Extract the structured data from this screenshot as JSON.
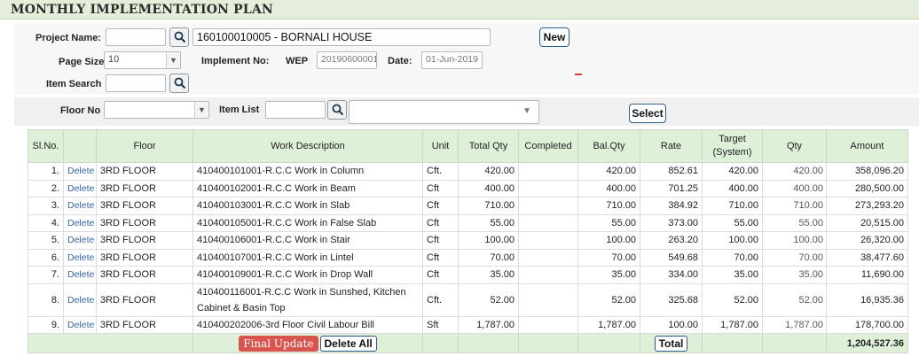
{
  "page": {
    "title": "MONTHLY IMPLEMENTATION PLAN"
  },
  "form": {
    "project_label": "Project Name:",
    "project_code": "",
    "project_name": "160100010005 - BORNALI HOUSE",
    "new_label": "New",
    "page_size_label": "Page Size",
    "page_size_value": "10",
    "implement_no_label": "Implement No:",
    "implement_prefix": "WEP",
    "implement_no_value": "20190600001",
    "date_label": "Date:",
    "date_value": "01-Jun-2019",
    "item_search_label": "Item Search",
    "item_search_value": "",
    "floor_label": "Floor No",
    "floor_value": "",
    "item_list_label": "Item List",
    "item_list_value": "",
    "item_list_select_value": "",
    "select_label": "Select"
  },
  "table": {
    "headers": {
      "sl": "Sl.No.",
      "floor": "Floor",
      "desc": "Work Description",
      "unit": "Unit",
      "total_qty": "Total Qty",
      "completed": "Completed",
      "bal_qty": "Bal.Qty",
      "rate": "Rate",
      "target_1": "Target",
      "target_2": "(System)",
      "qty": "Qty",
      "amount": "Amount"
    },
    "delete_label": "Delete",
    "rows": [
      {
        "sl": "1.",
        "floor": "3RD FLOOR",
        "desc": "410400101001-R.C.C Work in Column",
        "unit": "Cft.",
        "total_qty": "420.00",
        "completed": "",
        "bal_qty": "420.00",
        "rate": "852.61",
        "target": "420.00",
        "qty": "420.00",
        "amount": "358,096.20"
      },
      {
        "sl": "2.",
        "floor": "3RD FLOOR",
        "desc": "410400102001-R.C.C Work in Beam",
        "unit": "Cft",
        "total_qty": "400.00",
        "completed": "",
        "bal_qty": "400.00",
        "rate": "701.25",
        "target": "400.00",
        "qty": "400.00",
        "amount": "280,500.00"
      },
      {
        "sl": "3.",
        "floor": "3RD FLOOR",
        "desc": "410400103001-R.C.C Work in Slab",
        "unit": "Cft",
        "total_qty": "710.00",
        "completed": "",
        "bal_qty": "710.00",
        "rate": "384.92",
        "target": "710.00",
        "qty": "710.00",
        "amount": "273,293.20"
      },
      {
        "sl": "4.",
        "floor": "3RD FLOOR",
        "desc": "410400105001-R.C.C Work in False Slab",
        "unit": "Cft",
        "total_qty": "55.00",
        "completed": "",
        "bal_qty": "55.00",
        "rate": "373.00",
        "target": "55.00",
        "qty": "55.00",
        "amount": "20,515.00"
      },
      {
        "sl": "5.",
        "floor": "3RD FLOOR",
        "desc": "410400106001-R.C.C Work in Stair",
        "unit": "Cft",
        "total_qty": "100.00",
        "completed": "",
        "bal_qty": "100.00",
        "rate": "263.20",
        "target": "100.00",
        "qty": "100.00",
        "amount": "26,320.00"
      },
      {
        "sl": "6.",
        "floor": "3RD FLOOR",
        "desc": "410400107001-R.C.C Work in Lintel",
        "unit": "Cft",
        "total_qty": "70.00",
        "completed": "",
        "bal_qty": "70.00",
        "rate": "549.68",
        "target": "70.00",
        "qty": "70.00",
        "amount": "38,477.60"
      },
      {
        "sl": "7.",
        "floor": "3RD FLOOR",
        "desc": "410400109001-R.C.C Work in Drop Wall",
        "unit": "Cft",
        "total_qty": "35.00",
        "completed": "",
        "bal_qty": "35.00",
        "rate": "334.00",
        "target": "35.00",
        "qty": "35.00",
        "amount": "11,690.00"
      },
      {
        "sl": "8.",
        "floor": "3RD FLOOR",
        "desc": "410400116001-R.C.C Work in Sunshed, Kitchen Cabinet & Basin Top",
        "unit": "Cft.",
        "total_qty": "52.00",
        "completed": "",
        "bal_qty": "52.00",
        "rate": "325.68",
        "target": "52.00",
        "qty": "52.00",
        "amount": "16,935.36"
      },
      {
        "sl": "9.",
        "floor": "3RD FLOOR",
        "desc": "410400202006-3rd Floor Civil Labour Bill",
        "unit": "Sft",
        "total_qty": "1,787.00",
        "completed": "",
        "bal_qty": "1,787.00",
        "rate": "100.00",
        "target": "1,787.00",
        "qty": "1,787.00",
        "amount": "178,700.00"
      }
    ],
    "footer": {
      "final_update_label": "Final Update",
      "delete_all_label": "Delete All",
      "total_label": "Total",
      "grand_total": "1,204,527.36"
    }
  },
  "colors": {
    "header_green": "#dff0d8",
    "title_bar": "#e4eedb",
    "danger": "#d9534f",
    "link": "#3366aa"
  }
}
